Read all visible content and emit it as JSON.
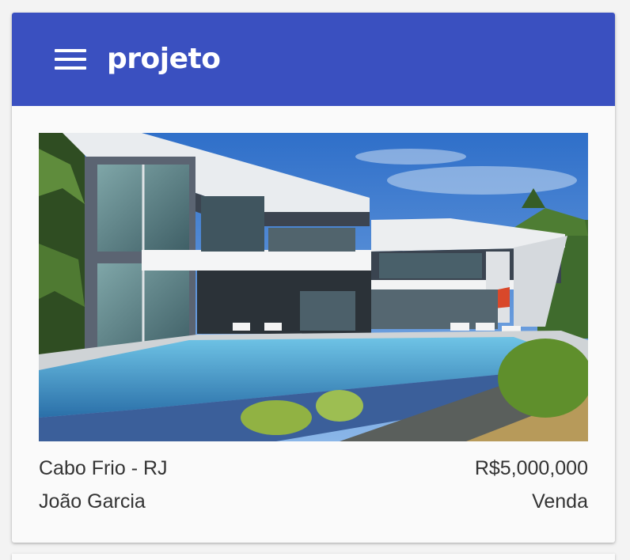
{
  "app": {
    "title": "projeto",
    "menu_icon": "menu-icon",
    "colors": {
      "appbar": "#3a50c0",
      "text": "#333333",
      "background": "#f3f3f3"
    }
  },
  "listing": {
    "location": "Cabo Frio - RJ",
    "price": "R$5,000,000",
    "owner": "João Garcia",
    "type": "Venda"
  }
}
